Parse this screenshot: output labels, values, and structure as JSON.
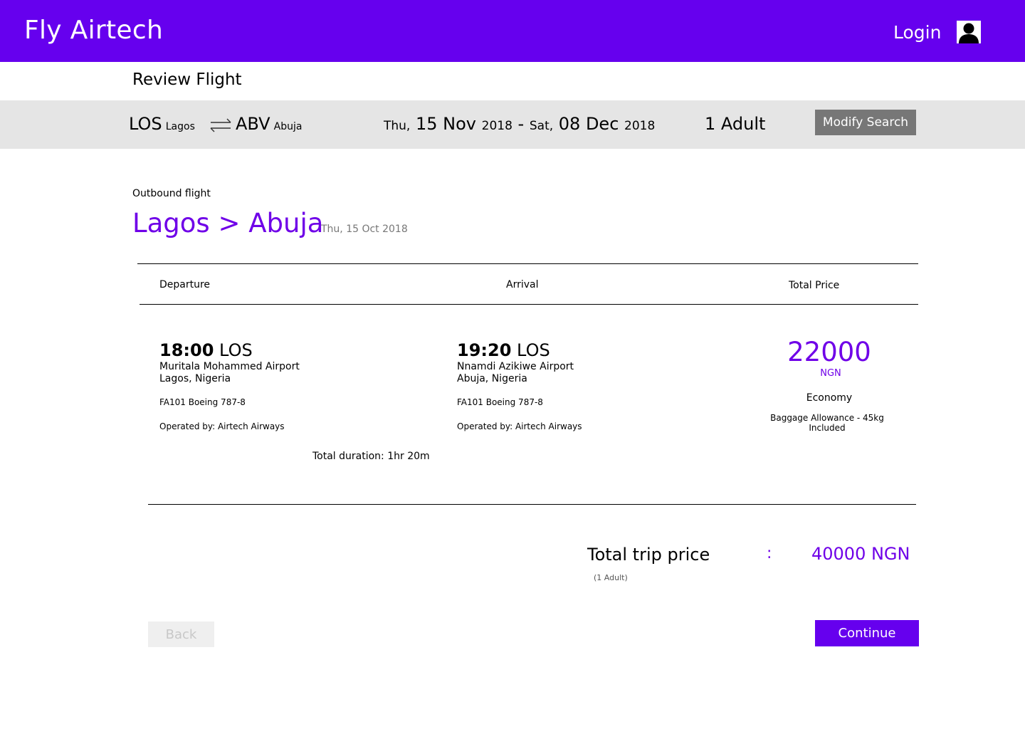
{
  "header": {
    "brand": "Fly Airtech",
    "login_label": "Login",
    "icon": "user-icon"
  },
  "page_title": "Review Flight",
  "search_summary": {
    "origin_code": "LOS",
    "origin_city": "Lagos",
    "destination_code": "ABV",
    "destination_city": "Abuja",
    "swap_icon": "swap-arrows-icon",
    "depart_day": "Thu,",
    "depart_date": "15 Nov",
    "depart_year": "2018",
    "separator": "-",
    "return_day": "Sat,",
    "return_date": "08 Dec",
    "return_year": "2018",
    "passengers": "1 Adult",
    "modify_label": "Modify Search"
  },
  "outbound": {
    "label": "Outbound flight",
    "route": "Lagos > Abuja",
    "date": "Thu, 15 Oct 2018"
  },
  "table": {
    "headers": [
      "Departure",
      "Arrival",
      "Total Price"
    ],
    "departure": {
      "time": "18:00",
      "code": "LOS",
      "airport": "Muritala Mohammed Airport",
      "location": "Lagos, Nigeria",
      "flight": "FA101 Boeing 787-8",
      "operator": "Operated by: Airtech Airways"
    },
    "arrival": {
      "time": "19:20",
      "code": "LOS",
      "airport": "Nnamdi Azikiwe Airport",
      "location": "Abuja, Nigeria",
      "flight": "FA101 Boeing 787-8",
      "operator": "Operated by: Airtech Airways"
    },
    "price": {
      "amount": "22000",
      "currency": "NGN",
      "cabin": "Economy",
      "baggage": "Baggage Allowance - 45kg Included"
    },
    "duration": "Total duration: 1hr 20m"
  },
  "trip_total": {
    "label": "Total trip price",
    "colon": ":",
    "value": "40000 NGN",
    "sub": "(1 Adult)"
  },
  "actions": {
    "back_label": "Back",
    "continue_label": "Continue"
  },
  "colors": {
    "brand": "#6600ee",
    "accent_text": "#6f00e8",
    "summary_bg": "#e5e5e5",
    "modify_bg": "#777777"
  }
}
